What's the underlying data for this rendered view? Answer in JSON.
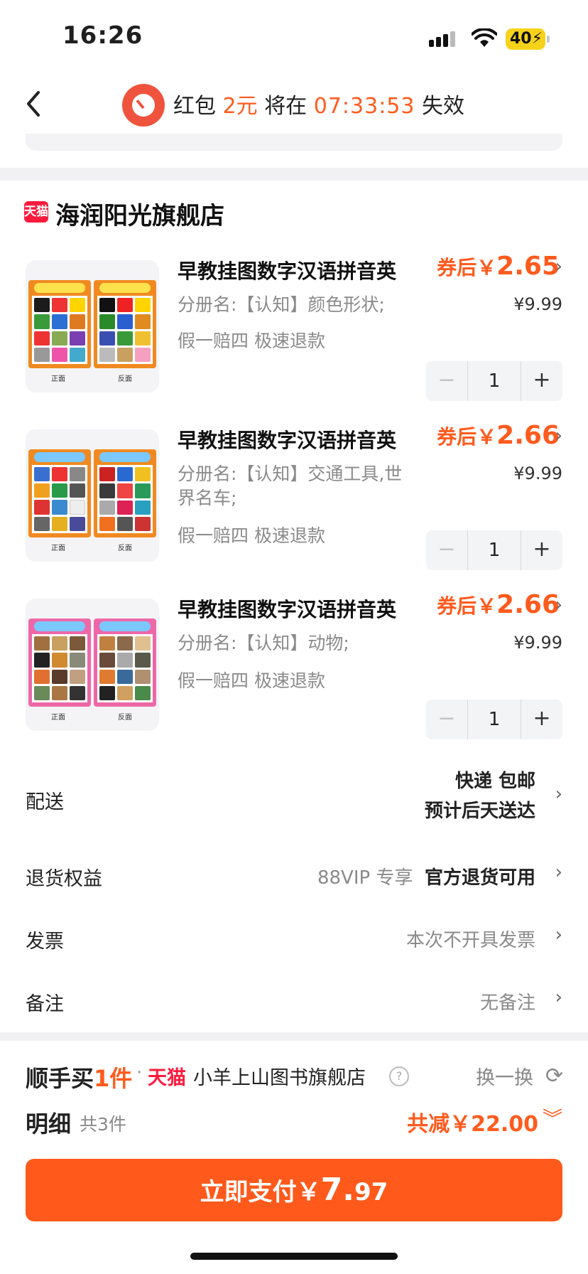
{
  "status": {
    "time": "16:26",
    "battery": "40"
  },
  "banner": {
    "prefix": "红包",
    "amount": "2元",
    "middle": "将在",
    "countdown": "07:33:53",
    "suffix": "失效"
  },
  "shop": {
    "badge": "天猫",
    "name": "海润阳光旗舰店"
  },
  "products": [
    {
      "title": "早教挂图数字汉语拼音英",
      "price_prefix": "券后￥",
      "price": "2.65",
      "original": "¥9.99",
      "spec": "分册名:【认知】颜色形状;",
      "tags": "假一赔四  极速退款",
      "qty": "1",
      "cap_front": "正面",
      "cap_back": "反面",
      "colors": [
        "#f08a20",
        "#f08a20"
      ]
    },
    {
      "title": "早教挂图数字汉语拼音英",
      "price_prefix": "券后￥",
      "price": "2.66",
      "original": "¥9.99",
      "spec": "分册名:【认知】交通工具,世界名车;",
      "tags": "假一赔四  极速退款",
      "qty": "1",
      "cap_front": "正面",
      "cap_back": "反面",
      "colors": [
        "#f08a20",
        "#f08a20"
      ]
    },
    {
      "title": "早教挂图数字汉语拼音英",
      "price_prefix": "券后￥",
      "price": "2.66",
      "original": "¥9.99",
      "spec": "分册名:【认知】动物;",
      "tags": "假一赔四  极速退款",
      "qty": "1",
      "cap_front": "正面",
      "cap_back": "反面",
      "colors": [
        "#ee68a8",
        "#ee68a8"
      ]
    }
  ],
  "delivery": {
    "label": "配送",
    "line1": "快递 包邮",
    "line2": "预计后天送达"
  },
  "returns": {
    "label": "退货权益",
    "note": "88VIP 专享",
    "value": "官方退货可用"
  },
  "invoice": {
    "label": "发票",
    "value": "本次不开具发票"
  },
  "remark": {
    "label": "备注",
    "value": "无备注"
  },
  "shunshou": {
    "logo_a": "顺手买",
    "logo_b": "1件",
    "dot": "·",
    "tmall": "天猫",
    "shop": "小羊上山图书旗舰店",
    "help": "?",
    "swap": "换一换"
  },
  "summary": {
    "detail": "明细",
    "count": "共3件",
    "discount": "共减￥22.00"
  },
  "pay": {
    "label": "立即支付￥",
    "amount_int": "7.",
    "amount_dec": "97"
  },
  "accent": "#ff5b1e"
}
